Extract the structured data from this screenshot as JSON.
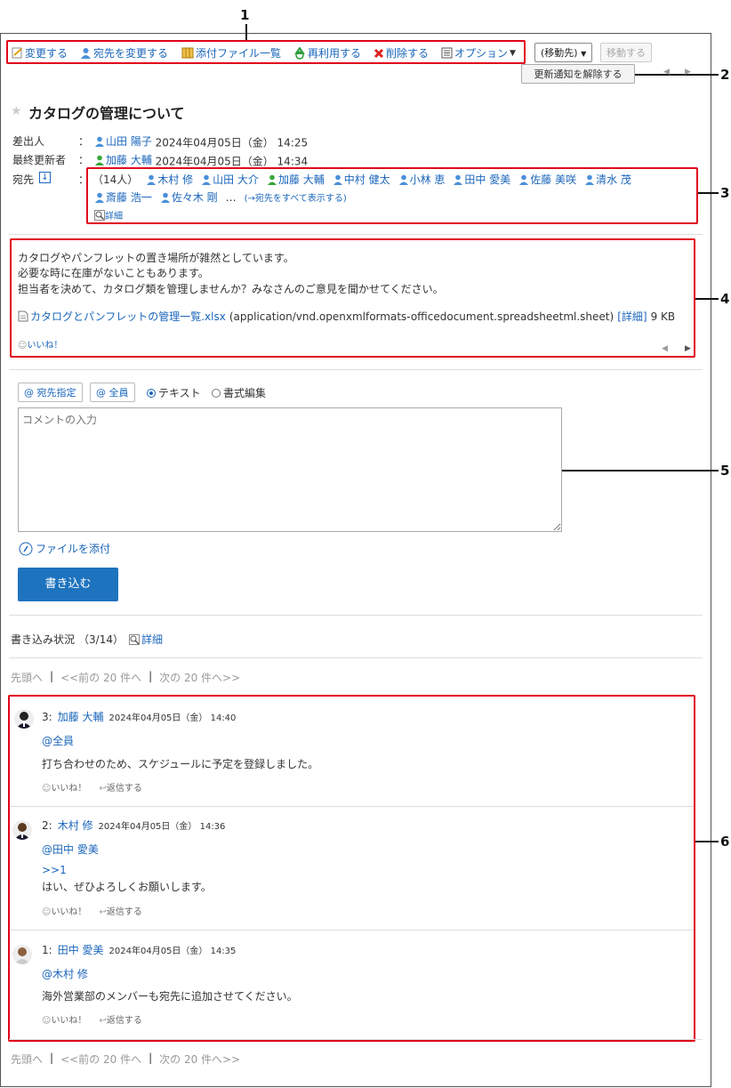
{
  "toolbar": {
    "edit": "変更する",
    "change_recipients": "宛先を変更する",
    "attachments_list": "添付ファイル一覧",
    "reuse": "再利用する",
    "delete": "削除する",
    "options": "オプション",
    "move_to_select": "(移動先)",
    "move_button": "移動する",
    "unsubscribe_button": "更新通知を解除する"
  },
  "message": {
    "title": "カタログの管理について",
    "sender_label": "差出人",
    "sender_name": "山田 陽子",
    "sender_datetime": "2024年04月05日（金） 14:25",
    "updater_label": "最終更新者",
    "updater_name": "加藤 大輔",
    "updater_datetime": "2024年04月05日（金） 14:34",
    "recipients_label": "宛先",
    "separator": "：",
    "recipient_count": "（14人）",
    "recipients_row1": [
      "木村 修",
      "山田 大介",
      "加藤 大輔",
      "中村 健太",
      "小林 恵",
      "田中 愛美",
      "佐藤 美咲",
      "清水 茂"
    ],
    "recipients_row2": [
      "斎藤 浩一",
      "佐々木 剛"
    ],
    "ellipsis": "…",
    "show_all": "(→宛先をすべて表示する)",
    "details": "詳細",
    "body_lines": [
      "カタログやパンフレットの置き場所が雑然としています。",
      "必要な時に在庫がないこともあります。",
      "担当者を決めて、カタログ類を管理しませんか？みなさんのご意見を聞かせてください。"
    ],
    "attachment_name": "カタログとパンフレットの管理一覧.xlsx",
    "attachment_type": "(application/vnd.openxmlformats-officedocument.spreadsheetml.sheet)",
    "attachment_details": "[詳細]",
    "attachment_size": "9 KB",
    "like": "いいね！"
  },
  "comment_form": {
    "mention_specify": "@ 宛先指定",
    "mention_all": "@ 全員",
    "mode_text": "テキスト",
    "mode_rich": "書式編集",
    "placeholder": "コメントの入力",
    "attach_file": "ファイルを添付",
    "submit": "書き込む"
  },
  "status": {
    "label": "書き込み状況",
    "count": "（3/14）",
    "details": "詳細"
  },
  "pager": {
    "first": "先頭へ",
    "sep": "|",
    "prev": "<<前の 20 件へ",
    "next": "次の 20 件へ>>"
  },
  "comments": [
    {
      "num": "3:",
      "author": "加藤 大輔",
      "datetime": "2024年04月05日（金） 14:40",
      "mention": "@全員",
      "quote": "",
      "text": "打ち合わせのため、スケジュールに予定を登録しました。",
      "like": "いいね！",
      "reply": "返信する"
    },
    {
      "num": "2:",
      "author": "木村 修",
      "datetime": "2024年04月05日（金） 14:36",
      "mention": "@田中 愛美",
      "quote": ">>1",
      "text": "はい、ぜひよろしくお願いします。",
      "like": "いいね！",
      "reply": "返信する"
    },
    {
      "num": "1:",
      "author": "田中 愛美",
      "datetime": "2024年04月05日（金） 14:35",
      "mention": "@木村 修",
      "quote": "",
      "text": "海外営業部のメンバーも宛先に追加させてください。",
      "like": "いいね！",
      "reply": "返信する"
    }
  ],
  "callouts": [
    "1",
    "2",
    "3",
    "4",
    "5",
    "6"
  ],
  "colors": {
    "accent": "#1a66bb",
    "callout": "#e0001b",
    "submit": "#1e73be"
  }
}
